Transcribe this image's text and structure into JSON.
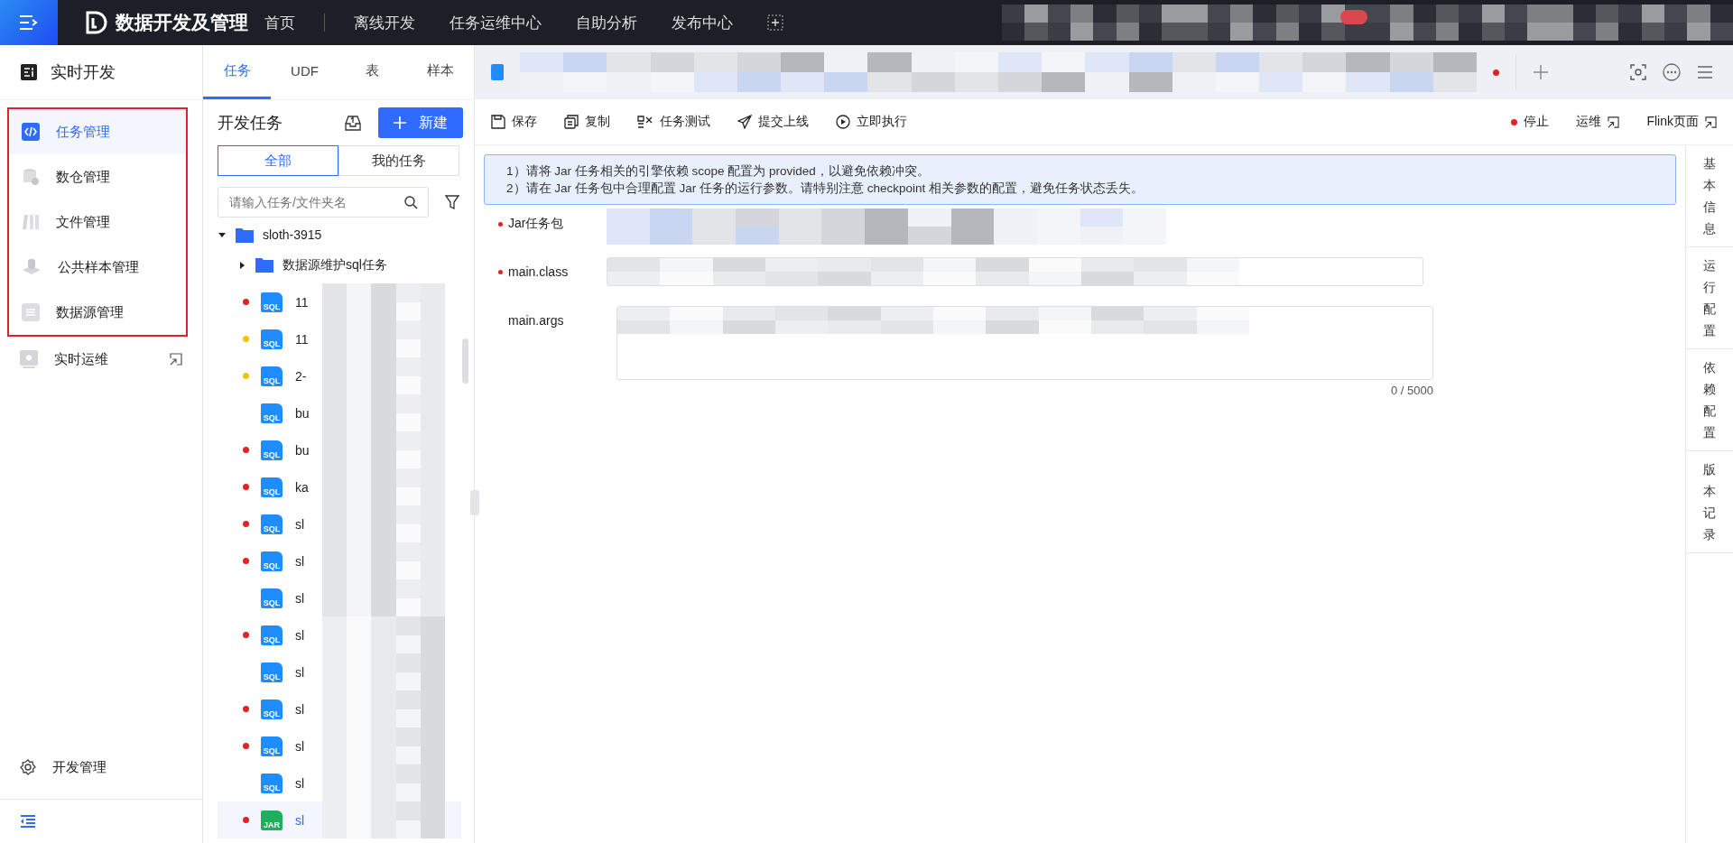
{
  "top_bar": {
    "app_title": "数据开发及管理",
    "nav": [
      {
        "label": "首页",
        "selected": false
      },
      {
        "label": "离线开发",
        "selected": false
      },
      {
        "label": "任务运维中心",
        "selected": false
      },
      {
        "label": "自助分析",
        "selected": false
      },
      {
        "label": "发布中心",
        "selected": false
      }
    ]
  },
  "sidebar": {
    "title": "实时开发",
    "annotated_items": [
      {
        "label": "任务管理",
        "kind": "code",
        "selected": true
      },
      {
        "label": "数仓管理",
        "kind": "warehouse",
        "selected": false
      },
      {
        "label": "文件管理",
        "kind": "files",
        "selected": false
      },
      {
        "label": "公共样本管理",
        "kind": "stack",
        "selected": false
      },
      {
        "label": "数据源管理",
        "kind": "datasource",
        "selected": false
      }
    ],
    "items": [
      {
        "label": "实时运维",
        "kind": "monitor",
        "selected": false,
        "external": true
      }
    ],
    "footer_item": {
      "label": "开发管理"
    }
  },
  "tree_panel": {
    "tabs": [
      {
        "label": "任务",
        "selected": true
      },
      {
        "label": "UDF",
        "selected": false
      },
      {
        "label": "表",
        "selected": false
      },
      {
        "label": "样本",
        "selected": false
      }
    ],
    "title": "开发任务",
    "new_button": "新建",
    "filters": [
      {
        "label": "全部",
        "selected": true
      },
      {
        "label": "我的任务",
        "selected": false
      }
    ],
    "search": {
      "placeholder": "请输入任务/文件夹名"
    },
    "tree": [
      {
        "kind": "folder",
        "label": "sloth-3915",
        "expanded": true,
        "children": [
          {
            "kind": "folder",
            "label": "数据源维护sql任务",
            "expanded": false
          },
          {
            "kind": "sql",
            "icon_text": "SQL",
            "label": "11",
            "color": "#e02424",
            "selected": false
          },
          {
            "kind": "sql",
            "icon_text": "SQL",
            "label": "11",
            "color": "#f5c400",
            "selected": false
          },
          {
            "kind": "sql",
            "icon_text": "SQL",
            "label": "2-",
            "color": "#f5c400",
            "selected": false
          },
          {
            "kind": "sql",
            "icon_text": "SQL",
            "label": "bu",
            "selected": false
          },
          {
            "kind": "sql",
            "icon_text": "SQL",
            "label": "bu",
            "color": "#e02424",
            "selected": false
          },
          {
            "kind": "sql",
            "icon_text": "SQL",
            "label": "ka",
            "color": "#e02424",
            "selected": false
          },
          {
            "kind": "sql",
            "icon_text": "SQL",
            "label": "sl",
            "color": "#e02424",
            "selected": false
          },
          {
            "kind": "sql",
            "icon_text": "SQL",
            "label": "sl",
            "color": "#e02424",
            "selected": false
          },
          {
            "kind": "sql",
            "icon_text": "SQL",
            "label": "sl",
            "selected": false
          },
          {
            "kind": "sql",
            "icon_text": "SQL",
            "label": "sl",
            "color": "#e02424",
            "selected": false
          },
          {
            "kind": "sql",
            "icon_text": "SQL",
            "label": "sl",
            "selected": false
          },
          {
            "kind": "sql",
            "icon_text": "SQL",
            "label": "sl",
            "color": "#e02424",
            "selected": false
          },
          {
            "kind": "sql",
            "icon_text": "SQL",
            "label": "sl",
            "color": "#e02424",
            "selected": false
          },
          {
            "kind": "sql",
            "icon_text": "SQL",
            "label": "sl",
            "selected": false
          },
          {
            "kind": "jar",
            "icon_text": "JAR",
            "label": "sl",
            "color": "#e02424",
            "selected": true
          }
        ]
      }
    ]
  },
  "toolbar": {
    "left": [
      {
        "kind": "save",
        "label": "保存"
      },
      {
        "kind": "copy",
        "label": "复制"
      },
      {
        "kind": "test",
        "label": "任务测试"
      },
      {
        "kind": "send",
        "label": "提交上线"
      },
      {
        "kind": "play",
        "label": "立即执行"
      }
    ],
    "right": [
      {
        "kind": "stop",
        "label": "停止"
      },
      {
        "kind": "link",
        "label": "运维"
      },
      {
        "kind": "link",
        "label": "Flink页面"
      }
    ]
  },
  "notice": [
    "1）请将 Jar 任务相关的引擎依赖 scope 配置为 provided，以避免依赖冲突。",
    "2）请在 Jar 任务包中合理配置 Jar 任务的运行参数。请特别注意 checkpoint 相关参数的配置，避免任务状态丢失。"
  ],
  "form": [
    {
      "kind": "upload",
      "label": "Jar任务包",
      "required": true
    },
    {
      "kind": "input",
      "label": "main.class",
      "required": true
    },
    {
      "kind": "textarea",
      "label": "main.args",
      "required": false,
      "counter": "0 / 5000"
    }
  ],
  "side_tabs": [
    {
      "label": "基本信息",
      "selected": false
    },
    {
      "label": "运行配置",
      "selected": false
    },
    {
      "label": "依赖配置",
      "selected": false
    },
    {
      "label": "版本记录",
      "selected": false
    }
  ]
}
